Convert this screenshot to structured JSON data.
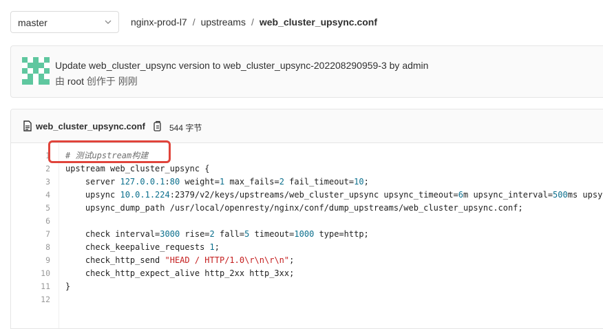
{
  "branch": {
    "selected": "master"
  },
  "breadcrumb": {
    "project": "nginx-prod-l7",
    "sep1": "/",
    "dir": "upstreams",
    "sep2": "/",
    "file": "web_cluster_upsync.conf"
  },
  "commit": {
    "title": "Update web_cluster_upsync version to web_cluster_upsync-202208290959-3 by admin",
    "meta_prefix": "由",
    "author": "root",
    "meta_suffix": "创作于 刚刚"
  },
  "file": {
    "name": "web_cluster_upsync.conf",
    "size": "544 字节"
  },
  "code": {
    "line_numbers": [
      "1",
      "2",
      "3",
      "4",
      "5",
      "6",
      "7",
      "8",
      "9",
      "10",
      "11",
      "12"
    ],
    "lines": [
      [
        {
          "t": "# 测试upstream构建",
          "k": "comment"
        }
      ],
      [
        {
          "t": "upstream web_cluster_upsync {",
          "k": "plain"
        }
      ],
      [
        {
          "t": "    server ",
          "k": "plain"
        },
        {
          "t": "127.0.0.1",
          "k": "num"
        },
        {
          "t": ":",
          "k": "plain"
        },
        {
          "t": "80",
          "k": "num"
        },
        {
          "t": " weight=",
          "k": "plain"
        },
        {
          "t": "1",
          "k": "num"
        },
        {
          "t": " max_fails=",
          "k": "plain"
        },
        {
          "t": "2",
          "k": "num"
        },
        {
          "t": " fail_timeout=",
          "k": "plain"
        },
        {
          "t": "10",
          "k": "num"
        },
        {
          "t": ";",
          "k": "plain"
        }
      ],
      [
        {
          "t": "    upsync ",
          "k": "plain"
        },
        {
          "t": "10.0.1.224",
          "k": "num"
        },
        {
          "t": ":2379/v2/keys/upstreams/web_cluster_upsync upsync_timeout=",
          "k": "plain"
        },
        {
          "t": "6",
          "k": "num"
        },
        {
          "t": "m upsync_interval=",
          "k": "plain"
        },
        {
          "t": "500",
          "k": "num"
        },
        {
          "t": "ms upsync_type=etcd strong_dependency=off;",
          "k": "plain"
        }
      ],
      [
        {
          "t": "    upsync_dump_path /usr/local/openresty/nginx/conf/dump_upstreams/web_cluster_upsync.conf;",
          "k": "plain"
        }
      ],
      [],
      [
        {
          "t": "    check interval=",
          "k": "plain"
        },
        {
          "t": "3000",
          "k": "num"
        },
        {
          "t": " rise=",
          "k": "plain"
        },
        {
          "t": "2",
          "k": "num"
        },
        {
          "t": " fall=",
          "k": "plain"
        },
        {
          "t": "5",
          "k": "num"
        },
        {
          "t": " timeout=",
          "k": "plain"
        },
        {
          "t": "1000",
          "k": "num"
        },
        {
          "t": " type=http;",
          "k": "plain"
        }
      ],
      [
        {
          "t": "    check_keepalive_requests ",
          "k": "plain"
        },
        {
          "t": "1",
          "k": "num"
        },
        {
          "t": ";",
          "k": "plain"
        }
      ],
      [
        {
          "t": "    check_http_send ",
          "k": "plain"
        },
        {
          "t": "\"HEAD / HTTP/1.0\\r\\n\\r\\n\"",
          "k": "str"
        },
        {
          "t": ";",
          "k": "plain"
        }
      ],
      [
        {
          "t": "    check_http_expect_alive http_2xx http_3xx;",
          "k": "plain"
        }
      ],
      [
        {
          "t": "}",
          "k": "plain"
        }
      ],
      []
    ]
  },
  "icons": {
    "branch_dropdown": "chevron-down-icon",
    "avatar": "identicon-avatar",
    "file": "file-text-icon",
    "copy": "copy-icon"
  },
  "colors": {
    "highlight": "#e0443b",
    "avatar": "#5fc79f"
  }
}
